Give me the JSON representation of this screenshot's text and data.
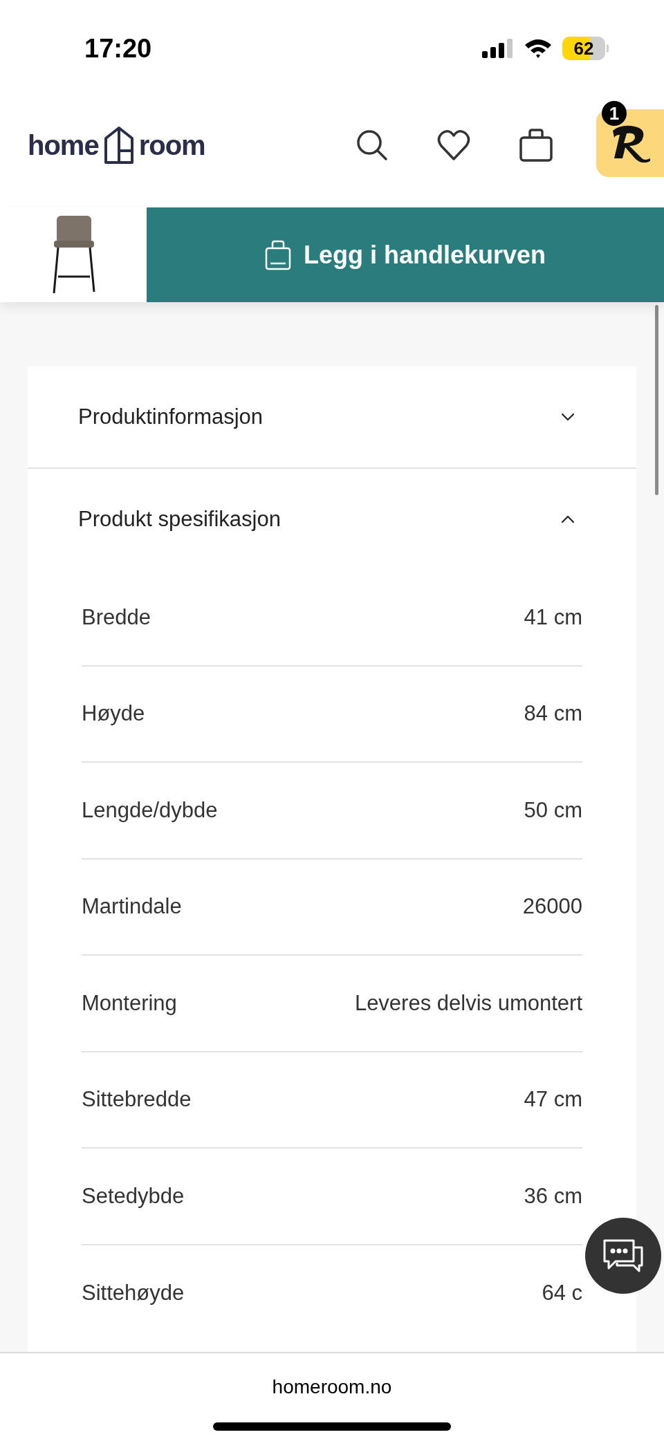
{
  "status_bar": {
    "time": "17:20",
    "battery": "62"
  },
  "header": {
    "logo": {
      "left": "home",
      "right": "room"
    },
    "badge": "1"
  },
  "sticky_bar": {
    "button": "Legg i handlekurven"
  },
  "accordion": [
    {
      "title": "Produktinformasjon",
      "expanded": false
    },
    {
      "title": "Produkt spesifikasjon",
      "expanded": true,
      "specs": [
        {
          "label": "Bredde",
          "value": "41 cm"
        },
        {
          "label": "Høyde",
          "value": "84 cm"
        },
        {
          "label": "Lengde/dybde",
          "value": "50 cm"
        },
        {
          "label": "Martindale",
          "value": "26000"
        },
        {
          "label": "Montering",
          "value": "Leveres delvis umontert"
        },
        {
          "label": "Sittebredde",
          "value": "47 cm"
        },
        {
          "label": "Setedybde",
          "value": "36 cm"
        },
        {
          "label": "Sittehøyde",
          "value": "64 c"
        }
      ]
    }
  ],
  "browser": {
    "url": "homeroom.no"
  }
}
